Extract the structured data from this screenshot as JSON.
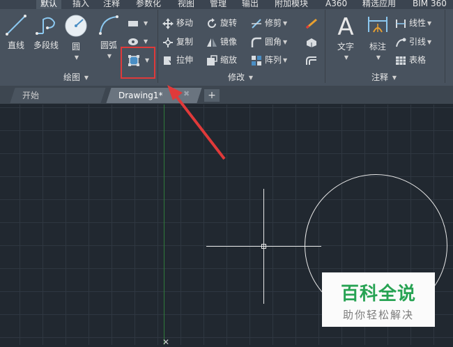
{
  "ribbon_tabs": [
    "默认",
    "插入",
    "注释",
    "参数化",
    "视图",
    "管理",
    "输出",
    "附加模块",
    "A360",
    "精选应用",
    "BIM 360"
  ],
  "draw_panel": {
    "label": "绘图",
    "line": "直线",
    "polyline": "多段线",
    "circle": "圆",
    "arc": "圆弧"
  },
  "modify_panel": {
    "label": "修改",
    "move": "移动",
    "rotate": "旋转",
    "trim": "修剪",
    "copy": "复制",
    "mirror": "镜像",
    "fillet": "圆角",
    "stretch": "拉伸",
    "scale": "缩放",
    "array": "阵列"
  },
  "annotation_panel": {
    "label": "注释",
    "text": "文字",
    "dimension": "标注",
    "linear": "线性",
    "leader": "引线",
    "table": "表格"
  },
  "doc_tabs": {
    "home": "开始",
    "drawing": "Drawing1*",
    "close": "✖",
    "add": "+"
  },
  "watermark": {
    "title": "百科全说",
    "subtitle": "助你轻松解决"
  },
  "colors": {
    "highlight": "#e03a3a",
    "arrow": "#e03a3a",
    "watermark_green": "#27a353",
    "axis_green": "#2f7a3a"
  }
}
